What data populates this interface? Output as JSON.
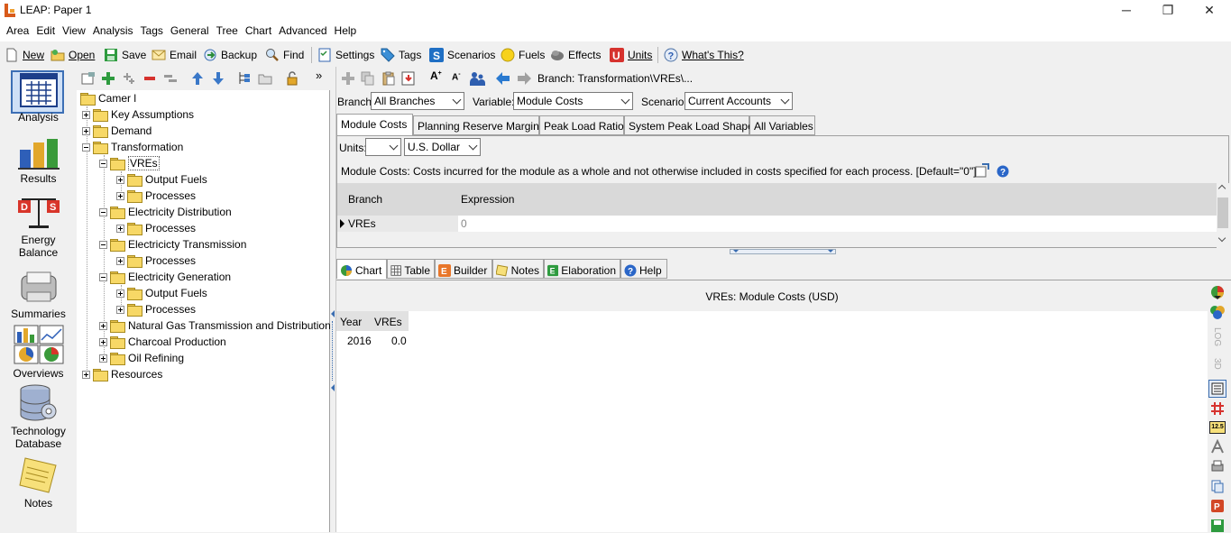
{
  "window": {
    "title": "LEAP: Paper 1",
    "minimize": "─",
    "maximize": "❐",
    "close": "✕"
  },
  "menu": [
    "Area",
    "Edit",
    "View",
    "Analysis",
    "Tags",
    "General",
    "Tree",
    "Chart",
    "Advanced",
    "Help"
  ],
  "toolbar": {
    "new": "New",
    "open": "Open",
    "save": "Save",
    "email": "Email",
    "backup": "Backup",
    "find": "Find",
    "settings": "Settings",
    "tags": "Tags",
    "scenarios": "Scenarios",
    "fuels": "Fuels",
    "effects": "Effects",
    "units": "Units",
    "whats_this": "What's This?"
  },
  "views": [
    {
      "label": "Analysis"
    },
    {
      "label": "Results"
    },
    {
      "label": "Energy Balance"
    },
    {
      "label": "Summaries"
    },
    {
      "label": "Overviews"
    },
    {
      "label": "Technology Database"
    },
    {
      "label": "Notes"
    }
  ],
  "tree": {
    "root": "Camer l",
    "nodes": [
      "Key Assumptions",
      "Demand",
      "Transformation",
      "VREs",
      "Output Fuels",
      "Processes",
      "Electricity Distribution",
      "Processes",
      "Electricicty Transmission",
      "Processes",
      "Electricity Generation",
      "Output Fuels",
      "Processes",
      "Natural Gas Transmission and Distribution",
      "Charcoal Production",
      "Oil Refining",
      "Resources"
    ]
  },
  "breadcrumb": "Branch: Transformation\\VREs\\...",
  "selectors": {
    "branch_label": "Branch:",
    "branch_value": "All Branches",
    "variable_label": "Variable:",
    "variable_value": "Module Costs",
    "scenario_label": "Scenario:",
    "scenario_value": "Current Accounts"
  },
  "tabs": [
    "Module Costs",
    "Planning Reserve Margin",
    "Peak Load Ratio",
    "System Peak Load Shape",
    "All Variables"
  ],
  "units": {
    "label": "Units:",
    "scale": "",
    "currency": "U.S. Dollar"
  },
  "description": "Module Costs: Costs incurred for the module as a whole and not otherwise included in costs specified for each process. [Default=\"0\"]",
  "grid": {
    "headers": [
      "Branch",
      "Expression"
    ],
    "rows": [
      {
        "branch": "VREs",
        "expression": "0"
      }
    ]
  },
  "bottom_tabs": [
    "Chart",
    "Table",
    "Builder",
    "Notes",
    "Elaboration",
    "Help"
  ],
  "chart_panel": {
    "title": "VREs: Module Costs (USD)",
    "table_headers": [
      "Year",
      "VREs"
    ],
    "table_rows": [
      [
        "2016",
        "0.0"
      ]
    ]
  },
  "side_tools": {
    "log": "LOG",
    "three_d": "3D",
    "number": "12.5"
  }
}
